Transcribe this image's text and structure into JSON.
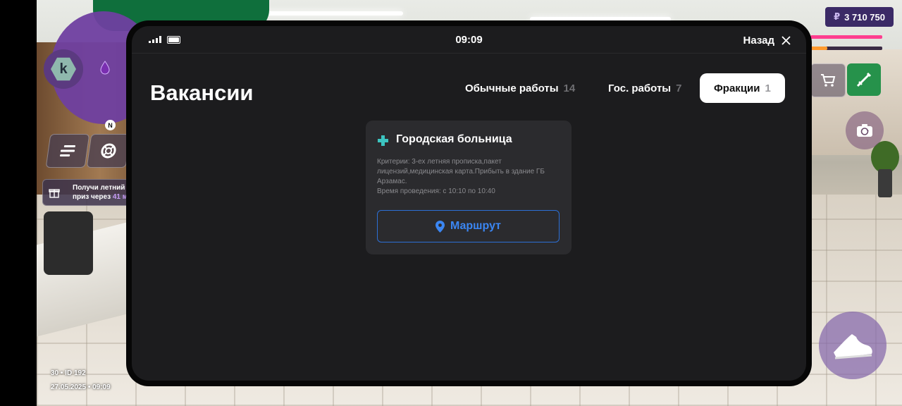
{
  "hud": {
    "money_currency": "₽",
    "money_amount": "3 710 750",
    "gift_banner": {
      "line1": "Получи летний",
      "line2": "приз через",
      "countdown": "41 м"
    },
    "compass_label": "N",
    "minimap_badge": "k",
    "session_line1": "30 • ID 192",
    "session_line2": "27.05.2025 • 09:09",
    "health_level": 1.0,
    "armor_level": 0.24
  },
  "phone": {
    "clock": "09:09",
    "back_label": "Назад",
    "title": "Вакансии",
    "tabs": [
      {
        "label": "Обычные работы",
        "count": "14",
        "active": false
      },
      {
        "label": "Гос. работы",
        "count": "7",
        "active": false
      },
      {
        "label": "Фракции",
        "count": "1",
        "active": true
      }
    ],
    "vacancy": {
      "title": "Городская больница",
      "criteria": "Критерии: 3-ех летняя прописка,пакет лицензий,медицинская карта.Прибыть в здание ГБ Арзамас.",
      "time": "Время проведения: с 10:10 по 10:40",
      "route_label": "Маршрут"
    }
  },
  "colors": {
    "accent_blue": "#3b86f2",
    "cross_teal": "#3cc4c0",
    "money_bg": "#3b2a66",
    "weapon_green": "#26924b",
    "health_pink": "#ff3d8f",
    "armor_orange": "#ff9a2e"
  },
  "icons": [
    "signal-icon",
    "battery-icon",
    "close-icon",
    "medical-cross-icon",
    "location-pin-icon",
    "menu-icon",
    "lifebuoy-icon",
    "gift-icon",
    "drop-icon",
    "cart-icon",
    "weapon-icon",
    "camera-rotate-icon",
    "sneaker-icon"
  ]
}
